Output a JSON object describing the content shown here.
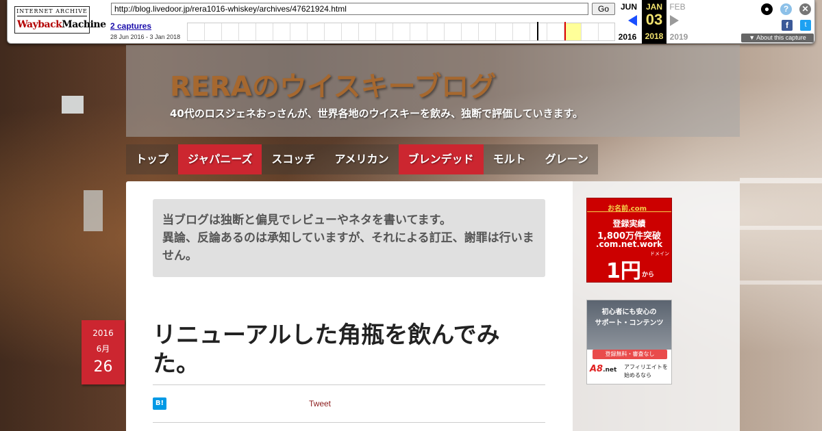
{
  "wayback": {
    "logo_top": "INTERNET ARCHIVE",
    "logo_main_a": "Wayback",
    "logo_main_b": "Machine",
    "url": "http://blog.livedoor.jp/rera1016-whiskey/archives/47621924.html",
    "go_label": "Go",
    "captures_label": "2 captures",
    "capture_range": "28 Jun 2016 - 3 Jan 2018",
    "prev_month": "JUN",
    "current_month": "JAN",
    "next_month": "FEB",
    "current_day": "03",
    "prev_year": "2016",
    "current_year": "2018",
    "next_year": "2019",
    "about_label": "▼ About this capture",
    "icons": [
      "user-icon",
      "help-icon",
      "close-icon",
      "facebook-icon",
      "twitter-icon"
    ]
  },
  "header": {
    "title": "RERAのウイスキーブログ",
    "description": "40代のロスジェネおっさんが、世界各地のウイスキーを飲み、独断で評価していきます。",
    "title_color": "#a6682f"
  },
  "nav": {
    "items": [
      {
        "label": "トップ",
        "active": false
      },
      {
        "label": "ジャパニーズ",
        "active": true
      },
      {
        "label": "スコッチ",
        "active": false
      },
      {
        "label": "アメリカン",
        "active": false
      },
      {
        "label": "ブレンデッド",
        "active": true
      },
      {
        "label": "モルト",
        "active": false
      },
      {
        "label": "グレーン",
        "active": false
      }
    ],
    "accent_color": "#cc2630"
  },
  "notice": {
    "line1": "当ブログは独断と偏見でレビューやネタを書いてます。",
    "line2": "異論、反論あるのは承知していますが、それによる訂正、謝罪は行いません。"
  },
  "post": {
    "date_year": "2016",
    "date_month": "6月",
    "date_day": "26",
    "title": "リニューアルした角瓶を飲んでみた。",
    "hatena_label": "B!",
    "tweet_label": "Tweet"
  },
  "ads": {
    "ad1": {
      "brand": "お名前.com",
      "line1": "登録実績",
      "line2": "1,800万件突破",
      "line3": ".com.net.work",
      "small": "ドメイン",
      "price": "1円",
      "suffix": "から"
    },
    "ad2": {
      "line1": "初心者にも安心の",
      "line2": "サポート・コンテンツ",
      "button": "登録無料・審査なし",
      "logo": "A8",
      "logo_suffix": ".net",
      "desc": "アフィリエイトを始めるなら"
    }
  }
}
